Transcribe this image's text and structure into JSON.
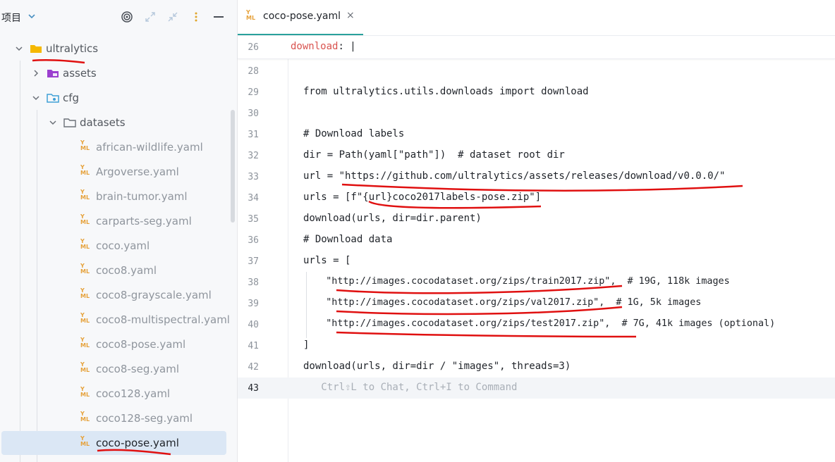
{
  "sidebar": {
    "title": "项目",
    "tree": [
      {
        "label": "ultralytics"
      },
      {
        "label": "assets"
      },
      {
        "label": "cfg"
      },
      {
        "label": "datasets"
      },
      {
        "label": "african-wildlife.yaml"
      },
      {
        "label": "Argoverse.yaml"
      },
      {
        "label": "brain-tumor.yaml"
      },
      {
        "label": "carparts-seg.yaml"
      },
      {
        "label": "coco.yaml"
      },
      {
        "label": "coco8.yaml"
      },
      {
        "label": "coco8-grayscale.yaml"
      },
      {
        "label": "coco8-multispectral.yaml"
      },
      {
        "label": "coco8-pose.yaml"
      },
      {
        "label": "coco8-seg.yaml"
      },
      {
        "label": "coco128.yaml"
      },
      {
        "label": "coco128-seg.yaml"
      },
      {
        "label": "coco-pose.yaml"
      }
    ],
    "yaml_icon_text": [
      "Y",
      "ML"
    ]
  },
  "editor": {
    "tab_label": "coco-pose.yaml",
    "tab_close": "×",
    "sticky": {
      "line": "26",
      "key": "download",
      "rest": ": |"
    },
    "lines": [
      {
        "num": "28",
        "text": ""
      },
      {
        "num": "29",
        "text": "from ultralytics.utils.downloads import download"
      },
      {
        "num": "30",
        "text": ""
      },
      {
        "num": "31",
        "text": "# Download labels"
      },
      {
        "num": "32",
        "text": "dir = Path(yaml[\"path\"])  # dataset root dir"
      },
      {
        "num": "33",
        "text": "url = \"https://github.com/ultralytics/assets/releases/download/v0.0.0/\""
      },
      {
        "num": "34",
        "text": "urls = [f\"{url}coco2017labels-pose.zip\"]"
      },
      {
        "num": "35",
        "text": "download(urls, dir=dir.parent)"
      },
      {
        "num": "36",
        "text": "# Download data"
      },
      {
        "num": "37",
        "text": "urls = ["
      },
      {
        "num": "38",
        "text": "    \"http://images.cocodataset.org/zips/train2017.zip\",  # 19G, 118k images"
      },
      {
        "num": "39",
        "text": "    \"http://images.cocodataset.org/zips/val2017.zip\",  # 1G, 5k images"
      },
      {
        "num": "40",
        "text": "    \"http://images.cocodataset.org/zips/test2017.zip\",  # 7G, 41k images (optional)"
      },
      {
        "num": "41",
        "text": "]"
      },
      {
        "num": "42",
        "text": "download(urls, dir=dir / \"images\", threads=3)"
      },
      {
        "num": "43",
        "text": "   Ctrl⇧L to Chat, Ctrl+I to Command"
      }
    ]
  },
  "colors": {
    "accent": "#2aa19b",
    "folder": "#f5b800",
    "yaml_icon": "#e6a23c",
    "annotation": "#e01010",
    "key": "#d9534f"
  },
  "icons": {
    "target": "target-icon",
    "expand": "expand-icon",
    "collapse": "collapse-icon",
    "more": "more-icon",
    "minimize": "minimize-icon"
  }
}
